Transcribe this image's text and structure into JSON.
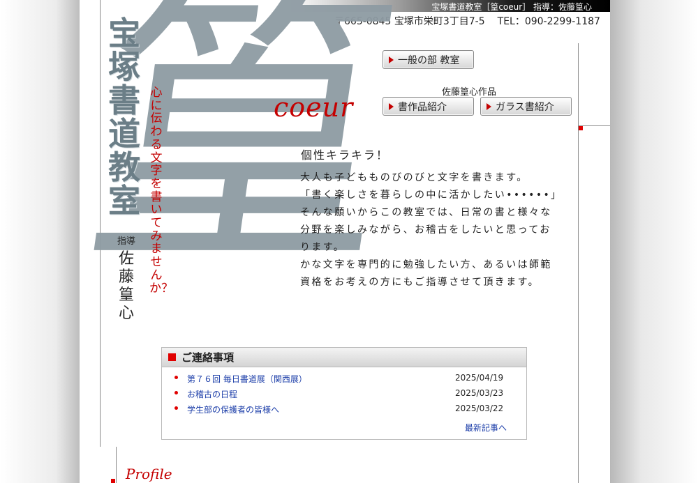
{
  "header": {
    "top_title": "宝塚書道教室［篁coeur］ 指導：佐藤篁心",
    "postal": "〒665-0845 宝塚市栄町3丁目7-5",
    "tel": "TEL：090-2299-1187"
  },
  "logo": {
    "big_char": "篁",
    "vertical_title": "宝塚書道教室",
    "tagline": "心に伝わる文字を書いてみませんか？",
    "instructor_label": "指導",
    "instructor_name": "佐藤篁心",
    "coeur": "coeur"
  },
  "nav": {
    "general_class": "一般の部 教室",
    "works_title": "佐藤篁心作品",
    "calligraphy_works": "書作品紹介",
    "glass_calligraphy": "ガラス書紹介"
  },
  "intro": {
    "title": "個性キラキラ！",
    "p1": "大人も子どもものびのびと文字を書きます。",
    "p2": "「書く楽しさを暮らしの中に活かしたい••••••」",
    "p3": "そんな願いからこの教室では、日常の書と様々な分野を楽しみながら、お稽古をしたいと思っております。",
    "p4": "かな文字を専門的に勉強したい方、あるいは師範資格をお考えの方にもご指導させて頂きます。"
  },
  "notices": {
    "heading": "ご連絡事項",
    "items": [
      {
        "title": "第７６回 毎日書道展（関西展）",
        "date": "2025/04/19"
      },
      {
        "title": "お稽古の日程",
        "date": "2025/03/23"
      },
      {
        "title": "学生部の保護者の皆様へ",
        "date": "2025/03/22"
      }
    ],
    "more": "最新記事へ"
  },
  "profile": {
    "label": "Profile"
  },
  "colors": {
    "accent_red": "#e00000",
    "link_blue": "#1a3ca8",
    "logo_gray": "#8e9ba3"
  }
}
